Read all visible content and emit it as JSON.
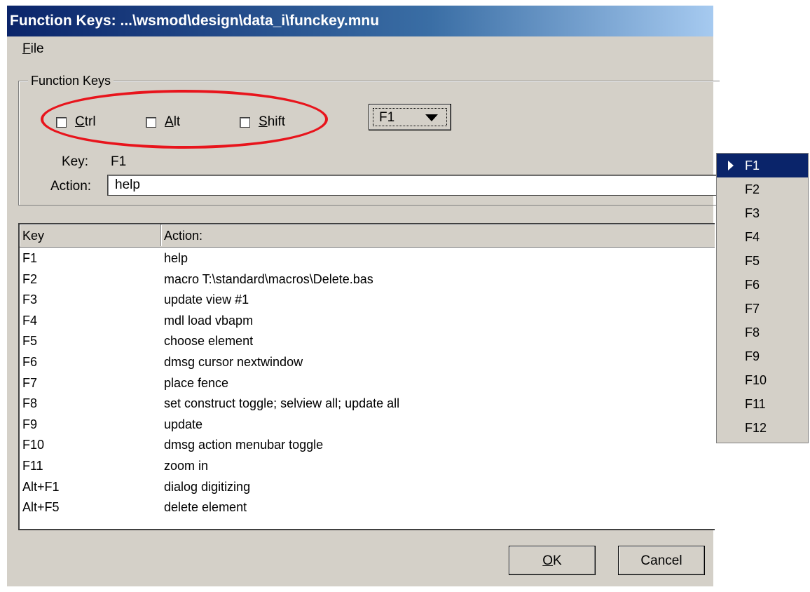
{
  "window": {
    "title": "Function Keys: ...\\wsmod\\design\\data_i\\funckey.mnu"
  },
  "menu": {
    "file_label": "File"
  },
  "group": {
    "label": "Function Keys",
    "ctrl_label": "Ctrl",
    "alt_label": "Alt",
    "shift_label": "Shift",
    "ctrl_checked": false,
    "alt_checked": false,
    "shift_checked": false,
    "key_select_value": "F1",
    "key_label": "Key:",
    "key_value": "F1",
    "action_label": "Action:",
    "action_value": "help"
  },
  "table": {
    "columns": [
      "Key",
      "Action:"
    ],
    "rows": [
      {
        "key": "F1",
        "action": "help"
      },
      {
        "key": "F2",
        "action": "macro T:\\standard\\macros\\Delete.bas"
      },
      {
        "key": "F3",
        "action": "update view #1"
      },
      {
        "key": "F4",
        "action": "mdl load vbapm"
      },
      {
        "key": "F5",
        "action": "choose element"
      },
      {
        "key": "F6",
        "action": "dmsg cursor nextwindow"
      },
      {
        "key": "F7",
        "action": "place fence"
      },
      {
        "key": "F8",
        "action": "set construct toggle; selview all; update all"
      },
      {
        "key": "F9",
        "action": "update"
      },
      {
        "key": "F10",
        "action": "dmsg action menubar toggle"
      },
      {
        "key": "F11",
        "action": "zoom in"
      },
      {
        "key": "Alt+F1",
        "action": "dialog digitizing"
      },
      {
        "key": "Alt+F5",
        "action": "delete element"
      }
    ]
  },
  "buttons": {
    "ok_label": "OK",
    "cancel_label": "Cancel"
  },
  "dropdown": {
    "options": [
      "F1",
      "F2",
      "F3",
      "F4",
      "F5",
      "F6",
      "F7",
      "F8",
      "F9",
      "F10",
      "F11",
      "F12"
    ],
    "selected": "F1"
  },
  "colors": {
    "annotation_oval": "#e8141c",
    "selection": "#0a246a",
    "dialog_bg": "#d4d0c8"
  }
}
